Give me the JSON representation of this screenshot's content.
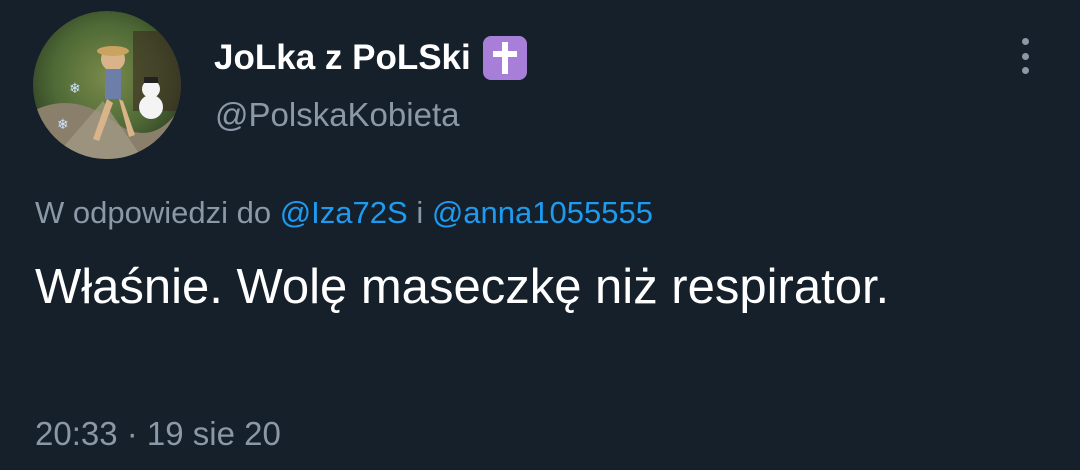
{
  "colors": {
    "background": "#15202b",
    "primary_text": "#ffffff",
    "secondary_text": "#8b98a5",
    "link": "#1d9bf0",
    "badge": "#a87fd8"
  },
  "author": {
    "display_name": "JoLka z PoLSki",
    "badge_icon": "latin-cross-emoji-icon",
    "handle": "@PolskaKobieta",
    "avatar_icon": "profile-photo-avatar"
  },
  "reply": {
    "prefix": "W odpowiedzi do",
    "mention_1": "@Iza72S",
    "conjunction": "i",
    "mention_2": "@anna1055555"
  },
  "tweet": {
    "text": "Właśnie. Wolę maseczkę niż respirator.",
    "timestamp": "20:33 · 19 sie 20"
  },
  "menu": {
    "icon": "more-vertical-icon"
  }
}
